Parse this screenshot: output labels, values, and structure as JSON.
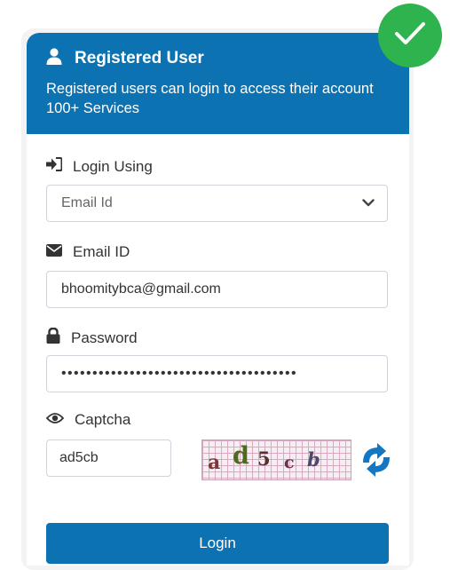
{
  "header": {
    "title": "Registered User",
    "description": "Registered users can login to access their account 100+ Services",
    "user_icon": "user-icon",
    "background": "#0d72b1"
  },
  "login_using": {
    "label": "Login Using",
    "icon": "sign-in-icon",
    "selected": "Email Id"
  },
  "email": {
    "label": "Email ID",
    "icon": "envelope-icon",
    "value": "bhoomitybca@gmail.com"
  },
  "password": {
    "label": "Password",
    "icon": "lock-icon",
    "masked_value": "••••••••••••••••••••••••••••••••••••••"
  },
  "captcha": {
    "label": "Captcha",
    "icon": "eye-icon",
    "value": "ad5cb",
    "image_chars": [
      "a",
      "d",
      "5",
      "c",
      "b"
    ],
    "refresh_icon": "refresh-icon"
  },
  "login_button": {
    "label": "Login"
  },
  "status_badge": {
    "icon": "checkmark-icon",
    "color": "#2eb34f"
  }
}
